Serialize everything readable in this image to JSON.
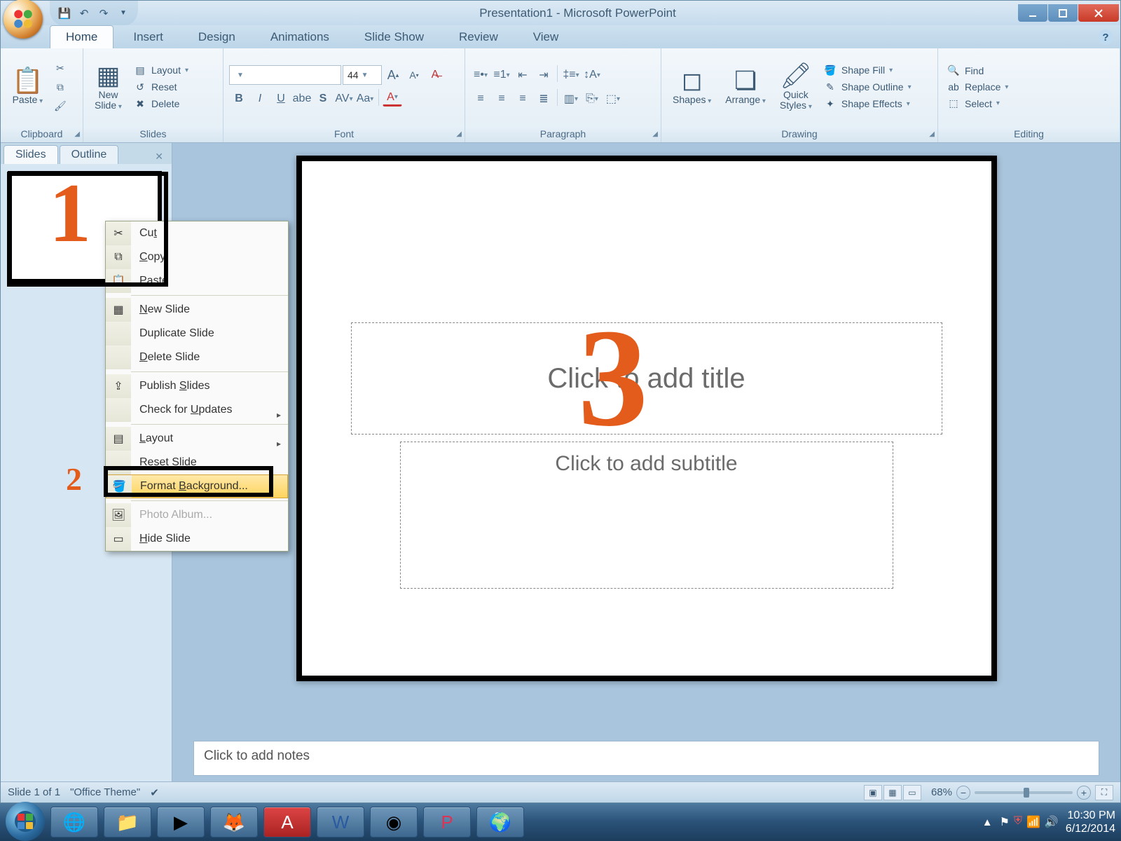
{
  "title_bar": {
    "doc": "Presentation1",
    "app": "Microsoft PowerPoint",
    "full": "Presentation1 - Microsoft PowerPoint"
  },
  "ribbon_tabs": [
    "Home",
    "Insert",
    "Design",
    "Animations",
    "Slide Show",
    "Review",
    "View"
  ],
  "groups": {
    "clipboard": {
      "label": "Clipboard",
      "paste": "Paste"
    },
    "slides": {
      "label": "Slides",
      "new_slide": "New\nSlide",
      "layout": "Layout",
      "reset": "Reset",
      "delete": "Delete"
    },
    "font": {
      "label": "Font",
      "size": "44"
    },
    "paragraph": {
      "label": "Paragraph"
    },
    "drawing": {
      "label": "Drawing",
      "shapes": "Shapes",
      "arrange": "Arrange",
      "quick": "Quick\nStyles",
      "fill": "Shape Fill",
      "outline": "Shape Outline",
      "effects": "Shape Effects"
    },
    "editing": {
      "label": "Editing",
      "find": "Find",
      "replace": "Replace",
      "select": "Select"
    }
  },
  "panel_tabs": {
    "slides": "Slides",
    "outline": "Outline"
  },
  "context_menu": {
    "cut": "Cut",
    "copy": "Copy",
    "paste": "Paste",
    "new": "New Slide",
    "duplicate": "Duplicate Slide",
    "delete": "Delete Slide",
    "publish": "Publish Slides",
    "updates": "Check for Updates",
    "layout": "Layout",
    "reset": "Reset Slide",
    "format_bg": "Format Background...",
    "photo": "Photo Album...",
    "hide": "Hide Slide"
  },
  "canvas": {
    "title": "Click to add title",
    "subtitle": "Click to add subtitle"
  },
  "notes": "Click to add notes",
  "status": {
    "slide": "Slide 1 of 1",
    "theme": "\"Office Theme\"",
    "zoom": "68%"
  },
  "annotations": {
    "one": "1",
    "two": "2",
    "three": "3"
  },
  "tray": {
    "time": "10:30 PM",
    "date": "6/12/2014"
  }
}
